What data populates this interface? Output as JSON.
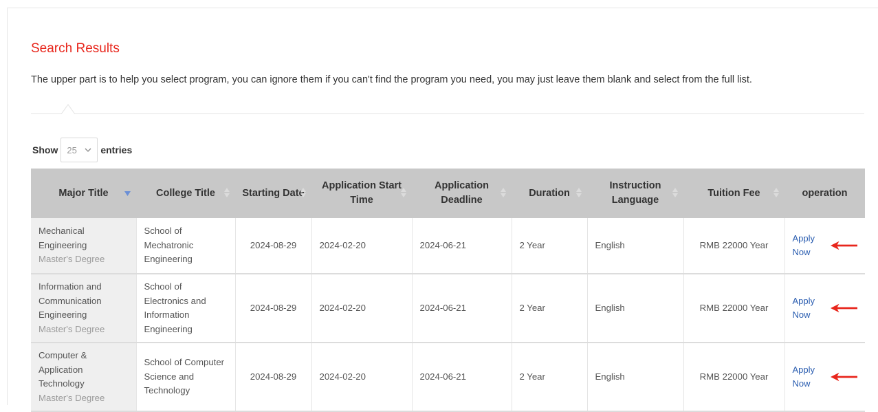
{
  "section": {
    "title": "Search Results",
    "intro": "The upper part is to help you select program, you can ignore them if you can't find the program you need, you may just leave them blank and select from the full list."
  },
  "length_control": {
    "show_label": "Show",
    "selected": "25",
    "entries_label": "entries"
  },
  "table": {
    "columns": [
      {
        "label": "Major Title",
        "sort": "desc-active"
      },
      {
        "label": "College Title",
        "sort": "none"
      },
      {
        "label": "Starting Date",
        "sort": "none"
      },
      {
        "label": "Application Start Time",
        "sort": "none"
      },
      {
        "label": "Application Deadline",
        "sort": "none"
      },
      {
        "label": "Duration",
        "sort": "none"
      },
      {
        "label": "Instruction Language",
        "sort": "none"
      },
      {
        "label": "Tuition Fee",
        "sort": "none"
      },
      {
        "label": "operation",
        "sort": "none"
      }
    ],
    "rows": [
      {
        "major": "Mechanical Engineering",
        "degree": "Master's Degree",
        "college": "School of Mechatronic Engineering",
        "starting_date": "2024-08-29",
        "application_start": "2024-02-20",
        "deadline": "2024-06-21",
        "duration": "2 Year",
        "language": "English",
        "tuition": "RMB 22000 Year",
        "action": "Apply Now"
      },
      {
        "major": "Information and Communication Engineering",
        "degree": "Master's Degree",
        "college": "School of Electronics and Information Engineering",
        "starting_date": "2024-08-29",
        "application_start": "2024-02-20",
        "deadline": "2024-06-21",
        "duration": "2 Year",
        "language": "English",
        "tuition": "RMB 22000 Year",
        "action": "Apply Now"
      },
      {
        "major": "Computer & Application Technology",
        "degree": "Master's Degree",
        "college": "School of Computer Science and Technology",
        "starting_date": "2024-08-29",
        "application_start": "2024-02-20",
        "deadline": "2024-06-21",
        "duration": "2 Year",
        "language": "English",
        "tuition": "RMB 22000 Year",
        "action": "Apply Now"
      }
    ]
  },
  "icons": {
    "sort": "sort-both-icon",
    "sort_active": "sort-desc-icon",
    "select_caret": "chevron-down-icon",
    "annotation": "red-arrow-icon"
  },
  "colors": {
    "title": "#e8261c",
    "header_bg": "#c8c8c8",
    "link": "#2a5db0",
    "arrow": "#e8261c",
    "sort_active": "#6b8fd6"
  }
}
